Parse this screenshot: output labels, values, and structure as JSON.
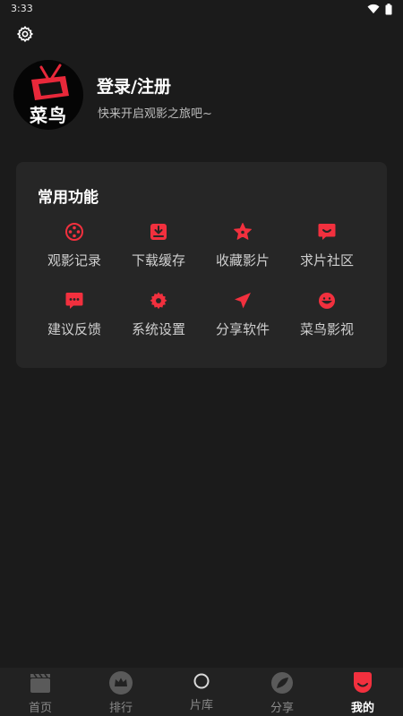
{
  "status_bar": {
    "time": "3:33",
    "icons": [
      "wifi-icon",
      "battery-icon"
    ]
  },
  "header": {
    "settings_icon": "gear-icon"
  },
  "profile": {
    "avatar_text": "菜鸟",
    "login_label": "登录/注册",
    "subtitle": "快来开启观影之旅吧~"
  },
  "functions": {
    "title": "常用功能",
    "accent_color": "#f2303e",
    "items": [
      {
        "label": "观影记录",
        "icon": "film-reel-icon"
      },
      {
        "label": "下载缓存",
        "icon": "download-icon"
      },
      {
        "label": "收藏影片",
        "icon": "star-icon"
      },
      {
        "label": "求片社区",
        "icon": "chat-bubble-icon"
      },
      {
        "label": "建议反馈",
        "icon": "feedback-icon"
      },
      {
        "label": "系统设置",
        "icon": "gear-icon"
      },
      {
        "label": "分享软件",
        "icon": "send-icon"
      },
      {
        "label": "菜鸟影视",
        "icon": "mascot-icon"
      }
    ]
  },
  "bottom_nav": {
    "items": [
      {
        "label": "首页",
        "icon": "clapper-icon",
        "active": false
      },
      {
        "label": "排行",
        "icon": "crown-icon",
        "active": false
      },
      {
        "label": "片库",
        "icon": "circle-icon",
        "active": false
      },
      {
        "label": "分享",
        "icon": "leaf-icon",
        "active": false
      },
      {
        "label": "我的",
        "icon": "profile-icon",
        "active": true
      }
    ],
    "active_color": "#f2303e"
  }
}
